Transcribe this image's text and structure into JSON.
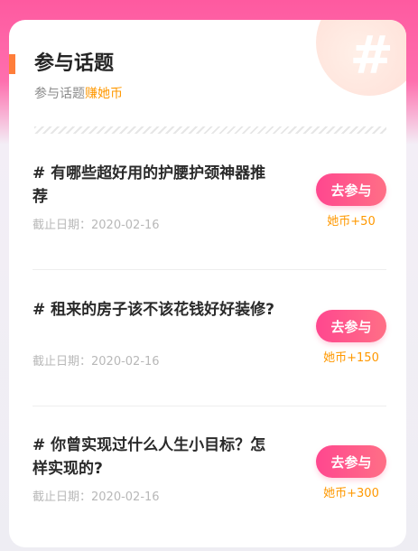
{
  "header": {
    "title": "参与话题",
    "subtitle_prefix": "参与话题",
    "subtitle_highlight": "赚她币",
    "deco_symbol": "#"
  },
  "topics": [
    {
      "title": "# 有哪些超好用的护腰护颈神器推荐",
      "deadline": "截止日期：2020-02-16",
      "button_label": "去参与",
      "reward": "她币+50"
    },
    {
      "title": "# 租来的房子该不该花钱好好装修?",
      "deadline": "截止日期：2020-02-16",
      "button_label": "去参与",
      "reward": "她币+150"
    },
    {
      "title": "# 你曾实现过什么人生小目标？怎样实现的?",
      "deadline": "截止日期：2020-02-16",
      "button_label": "去参与",
      "reward": "她币+300"
    }
  ],
  "colors": {
    "accent_pink": "#ff478f",
    "accent_orange": "#ff7e3a",
    "reward_orange": "#ff9800"
  }
}
